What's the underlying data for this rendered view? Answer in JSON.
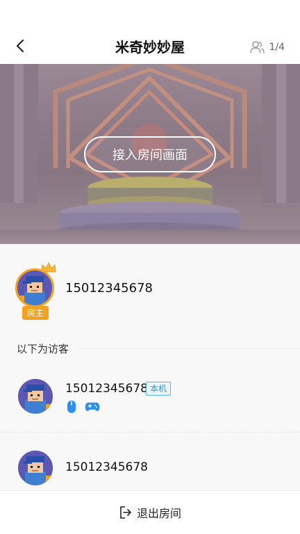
{
  "header": {
    "title": "米奇妙妙屋",
    "member_count": "1/4"
  },
  "stage": {
    "connect_label": "接入房间画面"
  },
  "host": {
    "name": "15012345678",
    "badge": "房主"
  },
  "guests_section": {
    "label": "以下为访客"
  },
  "guests": [
    {
      "name": "15012345678",
      "tag": "本机",
      "controls": [
        "mouse-icon",
        "gamepad-icon"
      ]
    },
    {
      "name": "15012345678"
    }
  ],
  "footer": {
    "exit_label": "退出房间"
  },
  "colors": {
    "accent_orange": "#f3a11e",
    "tag_blue": "#2f97e0",
    "control_blue": "#2d8ff0"
  }
}
